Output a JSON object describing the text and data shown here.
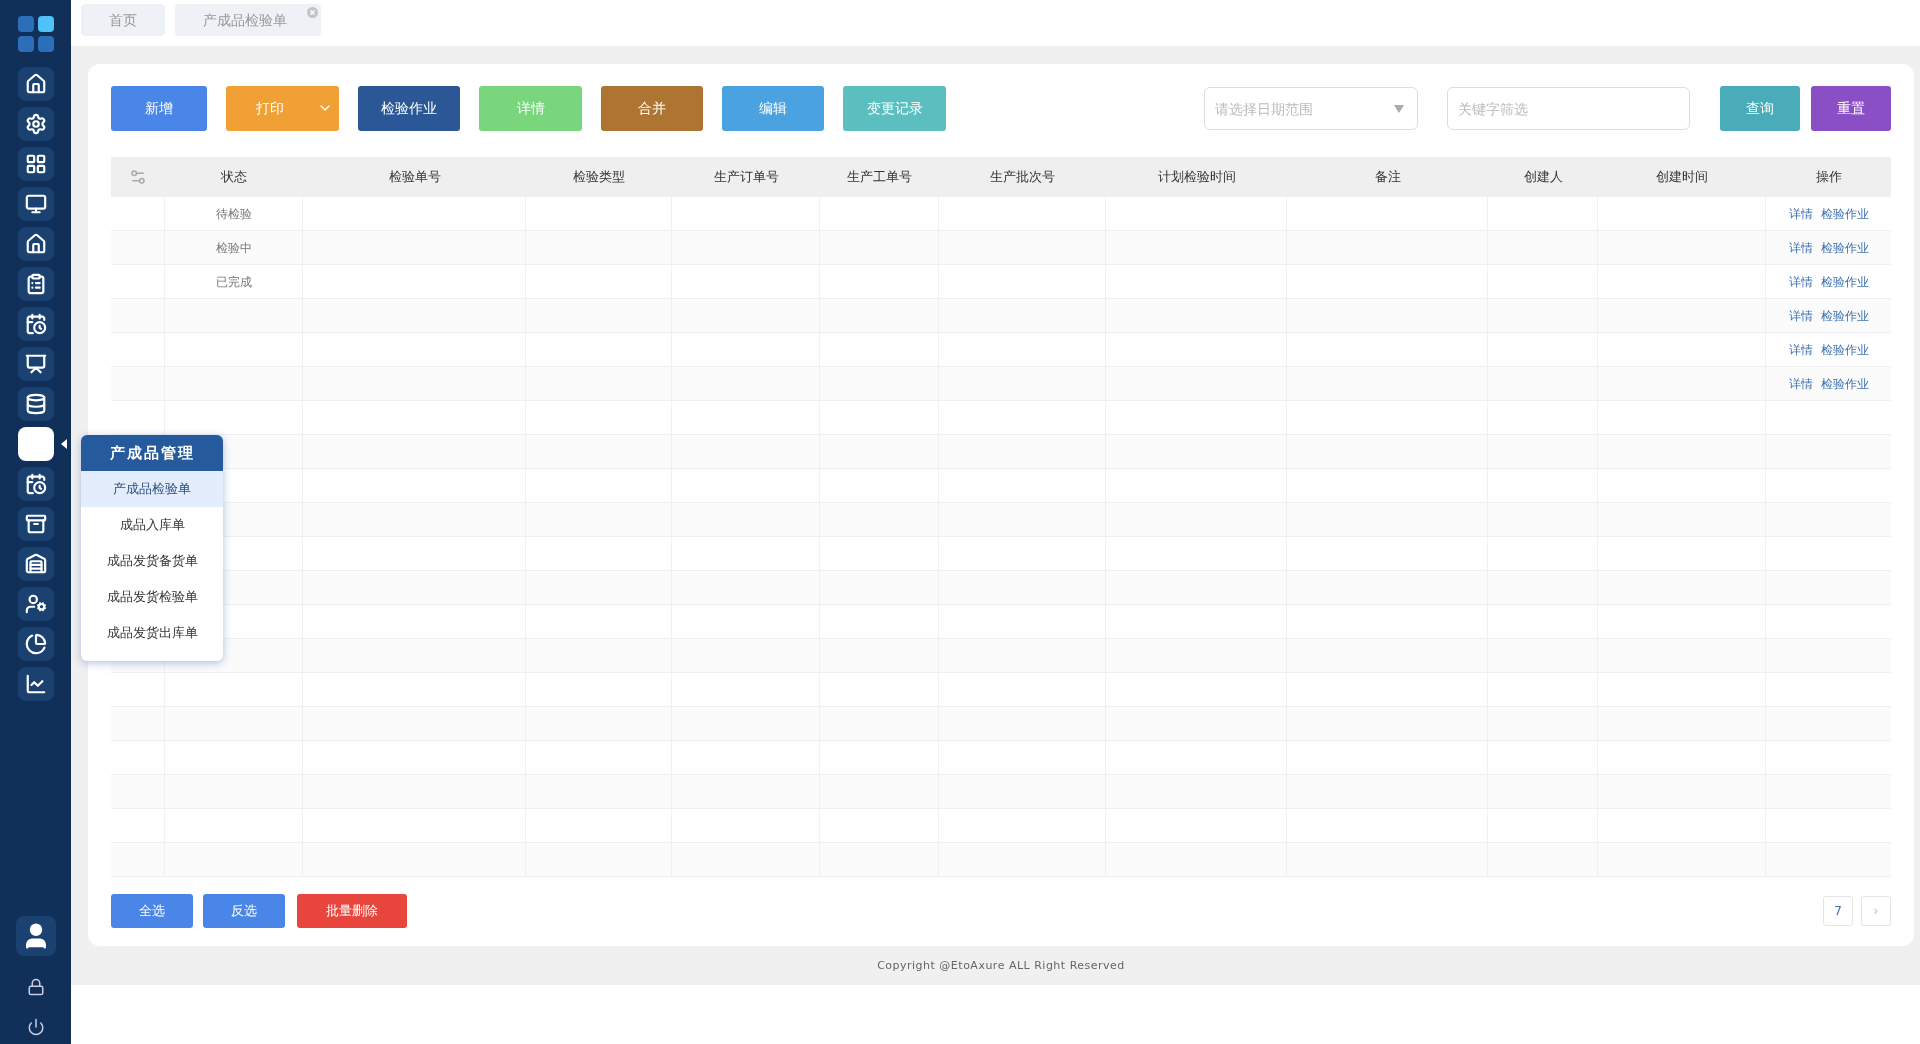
{
  "sidebar": {
    "items": [
      {
        "selected": false
      },
      {
        "selected": false
      },
      {
        "selected": false
      },
      {
        "selected": false
      },
      {
        "selected": false
      },
      {
        "selected": false
      },
      {
        "selected": false
      },
      {
        "selected": false
      },
      {
        "selected": false
      },
      {
        "selected": true
      },
      {
        "selected": false
      },
      {
        "selected": false
      },
      {
        "selected": false
      },
      {
        "selected": false
      },
      {
        "selected": false
      },
      {
        "selected": false
      }
    ]
  },
  "flyout_menu": {
    "title": "产成品管理",
    "items": [
      {
        "label": "产成品检验单",
        "selected": true
      },
      {
        "label": "成品入库单",
        "selected": false
      },
      {
        "label": "成品发货备货单",
        "selected": false
      },
      {
        "label": "成品发货检验单",
        "selected": false
      },
      {
        "label": "成品发货出库单",
        "selected": false
      }
    ]
  },
  "tabs": [
    {
      "label": "首页",
      "closable": false
    },
    {
      "label": "产成品检验单",
      "closable": true
    }
  ],
  "toolbar": {
    "buttons": [
      {
        "label": "新增",
        "kind": "plain",
        "color": "#4a86e8"
      },
      {
        "label": "打印",
        "kind": "dropdown",
        "color": "#f0a035"
      },
      {
        "label": "检验作业",
        "kind": "plain",
        "color": "#2b5797"
      },
      {
        "label": "详情",
        "kind": "plain",
        "color": "#79d67c"
      },
      {
        "label": "合并",
        "kind": "plain",
        "color": "#ae7431"
      },
      {
        "label": "编辑",
        "kind": "plain",
        "color": "#4aa3e0"
      },
      {
        "label": "变更记录",
        "kind": "plain",
        "color": "#5bbfbf"
      }
    ],
    "date_range": {
      "placeholder": "请选择日期范围"
    },
    "keyword": {
      "placeholder": "关键字筛选"
    },
    "actions": [
      {
        "label": "查询",
        "color": "#4aabb9"
      },
      {
        "label": "重置",
        "color": "#8b4fc5"
      }
    ]
  },
  "table": {
    "columns": [
      "状态",
      "检验单号",
      "检验类型",
      "生产订单号",
      "生产工单号",
      "生产批次号",
      "计划检验时间",
      "备注",
      "创建人",
      "创建时间",
      "操作"
    ],
    "rows": [
      {
        "status": "待检验",
        "actions": [
          "详情",
          "检验作业"
        ]
      },
      {
        "status": "检验中",
        "actions": [
          "详情",
          "检验作业"
        ]
      },
      {
        "status": "已完成",
        "actions": [
          "详情",
          "检验作业"
        ]
      },
      {
        "actions": [
          "详情",
          "检验作业"
        ]
      },
      {
        "actions": [
          "详情",
          "检验作业"
        ]
      },
      {
        "actions": [
          "详情",
          "检验作业"
        ]
      }
    ]
  },
  "bottom_buttons": [
    {
      "label": "全选",
      "color": "#4a86e8"
    },
    {
      "label": "反选",
      "color": "#4a86e8"
    },
    {
      "label": "批量删除",
      "color": "#e8453c"
    }
  ],
  "pagination": {
    "page": "7",
    "next": "›"
  },
  "footer": "Copyright @EtoAxure ALL Right Reserved"
}
